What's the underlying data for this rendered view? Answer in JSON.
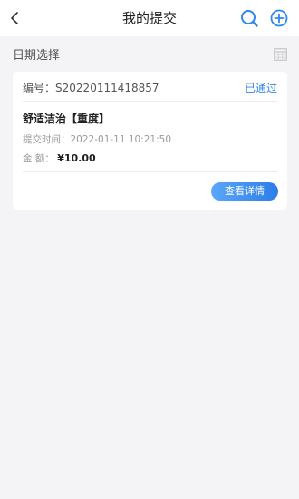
{
  "header": {
    "title": "我的提交",
    "back_icon": "chevron-left-icon",
    "search_icon": "search-icon",
    "add_icon": "add-circle-icon"
  },
  "filter": {
    "label": "日期选择",
    "calendar_icon": "calendar-icon"
  },
  "submissions": [
    {
      "order_label": "编号",
      "order_sep": "：",
      "order_no": "S20220111418857",
      "status": "已通过",
      "title": "舒适洁治【重度】",
      "time_label": "提交时间：",
      "time_value": "2022-01-11 10:21:50",
      "amount_label": "金 额：",
      "amount_value": "¥10.00",
      "detail_button": "查看详情"
    }
  ],
  "colors": {
    "accent": "#2f86ee",
    "background": "#f4f4f6",
    "card": "#ffffff"
  }
}
